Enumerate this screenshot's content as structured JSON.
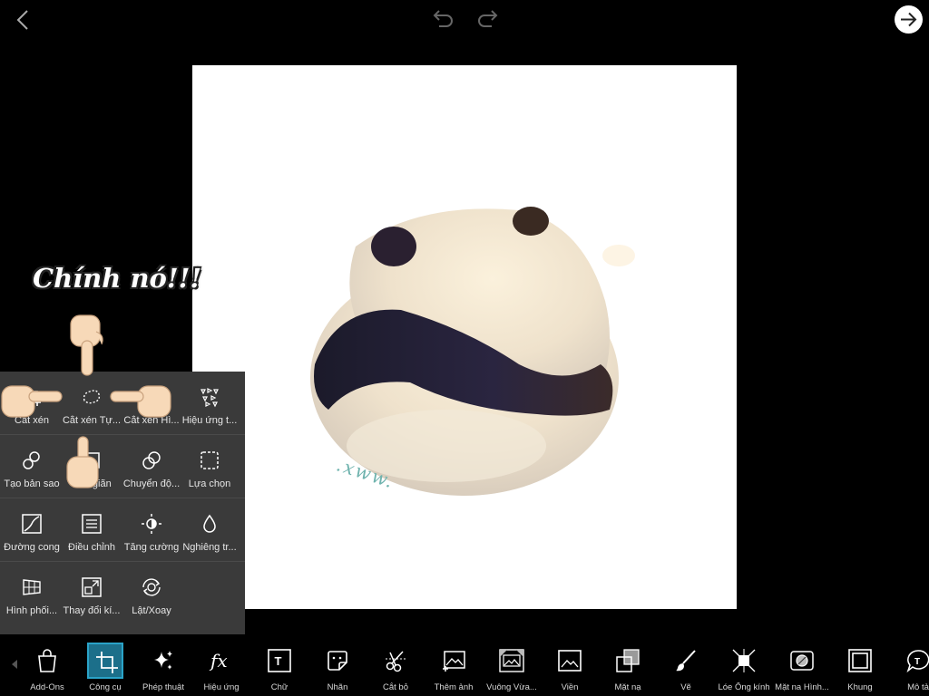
{
  "sticker": {
    "text": "Chính nó!!!"
  },
  "canvas": {
    "watermark": ".xww."
  },
  "tools": {
    "rows": [
      [
        {
          "label": "Cắt xén",
          "icon": "crop-icon"
        },
        {
          "label": "Cắt xén Tự...",
          "icon": "freecrop-icon"
        },
        {
          "label": "Cắt xén Hì...",
          "icon": "shapecrop-icon"
        },
        {
          "label": "Hiệu ứng t...",
          "icon": "dispersion-icon"
        }
      ],
      [
        {
          "label": "Tạo bản sao",
          "icon": "clone-icon"
        },
        {
          "label": "Kéo giãn",
          "icon": "stretch-icon"
        },
        {
          "label": "Chuyển độ...",
          "icon": "motion-icon"
        },
        {
          "label": "Lựa chọn",
          "icon": "selection-icon"
        }
      ],
      [
        {
          "label": "Đường cong",
          "icon": "curves-icon"
        },
        {
          "label": "Điều chỉnh",
          "icon": "adjust-icon"
        },
        {
          "label": "Tăng cường",
          "icon": "enhance-icon"
        },
        {
          "label": "Nghiêng tr...",
          "icon": "tiltshift-icon"
        }
      ],
      [
        {
          "label": "Hình phối...",
          "icon": "perspective-icon"
        },
        {
          "label": "Thay đổi kí...",
          "icon": "resize-icon"
        },
        {
          "label": "Lật/Xoay",
          "icon": "fliprotate-icon"
        }
      ]
    ]
  },
  "bottombar": {
    "items": [
      {
        "label": "Add-Ons",
        "icon": "shopping-bag-icon"
      },
      {
        "label": "Công cụ",
        "icon": "crop-tool-icon",
        "active": true
      },
      {
        "label": "Phép thuật",
        "icon": "sparkle-icon"
      },
      {
        "label": "Hiệu ứng",
        "icon": "fx-icon"
      },
      {
        "label": "Chữ",
        "icon": "text-icon"
      },
      {
        "label": "Nhãn",
        "icon": "sticker-icon"
      },
      {
        "label": "Cắt bỏ",
        "icon": "cutout-icon"
      },
      {
        "label": "Thêm ảnh",
        "icon": "add-photo-icon"
      },
      {
        "label": "Vuông Vừa...",
        "icon": "square-fit-icon"
      },
      {
        "label": "Viền",
        "icon": "border-icon"
      },
      {
        "label": "Mặt nạ",
        "icon": "mask-icon"
      },
      {
        "label": "Vẽ",
        "icon": "brush-icon"
      },
      {
        "label": "Lóe Ống kính",
        "icon": "lens-flare-icon"
      },
      {
        "label": "Mặt na Hình...",
        "icon": "shape-mask-icon"
      },
      {
        "label": "Khung",
        "icon": "frame-icon"
      },
      {
        "label": "Mô tả",
        "icon": "callout-icon"
      }
    ]
  }
}
